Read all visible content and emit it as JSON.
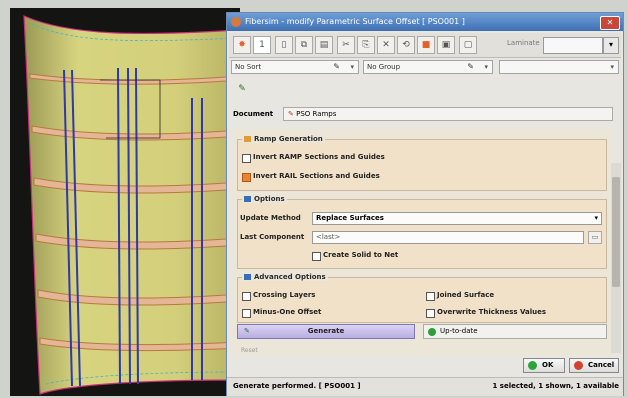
{
  "window": {
    "title": "Fibersim - modify Parametric Surface Offset [ PSO001 ]",
    "close_label": "✕"
  },
  "toolbar": {
    "step_value": "1",
    "laminate_label": "Laminate",
    "laminate_value": ""
  },
  "filters": {
    "sort_value": "No Sort",
    "group_value": "No Group",
    "third_value": ""
  },
  "document": {
    "label": "Document",
    "value": "PSO Ramps"
  },
  "ramp_generation": {
    "header": "Ramp Generation",
    "invert_ramp_label": "Invert RAMP Sections and Guides",
    "invert_ramp_checked": false,
    "invert_rail_label": "Invert RAIL Sections and Guides",
    "invert_rail_checked": true
  },
  "options": {
    "header": "Options",
    "update_method_label": "Update Method",
    "update_method_value": "Replace Surfaces",
    "last_component_label": "Last Component",
    "last_component_value": "<last>",
    "create_solid_label": "Create Solid to Net",
    "create_solid_checked": false
  },
  "advanced": {
    "header": "Advanced Options",
    "crossing_layers_label": "Crossing Layers",
    "joined_surface_label": "Joined Surface",
    "minus_one_offset_label": "Minus-One Offset",
    "overwrite_thickness_label": "Overwrite Thickness Values"
  },
  "generate": {
    "button_label": "Generate",
    "status_text": "Up-to-date"
  },
  "reset_label": "Reset",
  "actions": {
    "ok_label": "OK",
    "cancel_label": "Cancel"
  },
  "statusbar": {
    "left_text": "Generate performed. [ PSO001 ]",
    "right_text": "1 selected, 1 shown, 1 available"
  },
  "colors": {
    "surface": "#d3d07a",
    "section_band": "#e0b79a",
    "guide_lines": "#2e3aa8",
    "boundary": "#cc2f7a",
    "section_panel": "#f0e1c8",
    "generate_button": "#c3b9e8"
  }
}
